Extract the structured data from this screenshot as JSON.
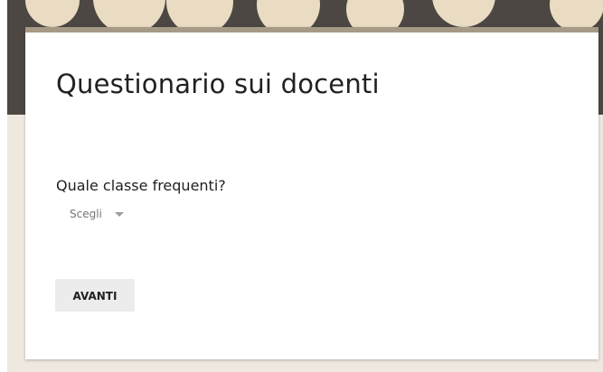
{
  "form": {
    "title": "Questionario sui docenti",
    "question": {
      "label": "Quale classe frequenti?",
      "dropdown_value": "Scegli"
    },
    "next_button_label": "AVANTI"
  },
  "colors": {
    "header_background": "#4d4743",
    "card_accent": "#a69a86",
    "page_background": "#eee8df",
    "button_background": "#ececec"
  }
}
